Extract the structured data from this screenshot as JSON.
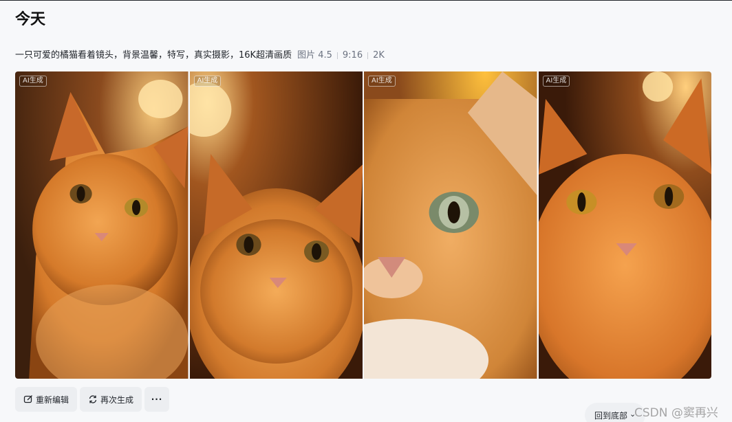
{
  "header": {
    "title": "今天"
  },
  "prompt": {
    "text": "一只可爱的橘猫看着镜头，背景温馨，特写，真实摄影，16K超清画质",
    "model": "图片 4.5",
    "ratio": "9:16",
    "resolution": "2K"
  },
  "images": [
    {
      "badge": "AI生成",
      "subject": "orange tabby cat, lamp background"
    },
    {
      "badge": "AI生成",
      "subject": "orange tabby cat, warm bokeh"
    },
    {
      "badge": "AI生成",
      "subject": "orange cat close-up, green eyes"
    },
    {
      "badge": "AI生成",
      "subject": "orange tabby cat, amber eyes"
    }
  ],
  "actions": {
    "re_edit": "重新编辑",
    "regenerate": "再次生成",
    "more": "···",
    "icons": [
      "edit-icon",
      "refresh-icon",
      "more-dots-icon"
    ]
  },
  "scroll": {
    "to_bottom": "回到底部",
    "icon": "chevron-down-icon"
  },
  "watermark": "CSDN @窦再兴",
  "colors": {
    "background": "#f7f8fa",
    "button": "#eceef1",
    "text": "#1f2329",
    "meta": "#6b7280"
  }
}
